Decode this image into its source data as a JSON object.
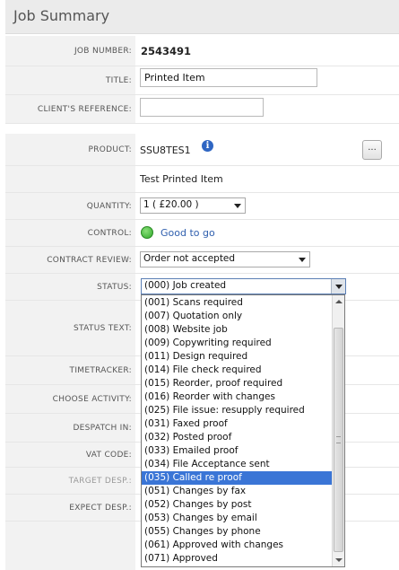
{
  "header": {
    "title": "Job Summary"
  },
  "fields": {
    "job_number": {
      "label": "JOB NUMBER:",
      "value": "2543491"
    },
    "title": {
      "label": "TITLE:",
      "value": "Printed Item"
    },
    "client_reference": {
      "label": "CLIENT'S REFERENCE:",
      "value": ""
    },
    "product": {
      "label": "PRODUCT:",
      "code": "SSU8TES1",
      "more_label": "...",
      "name": "Test Printed Item"
    },
    "quantity": {
      "label": "QUANTITY:",
      "value": "1 ( £20.00 )"
    },
    "control": {
      "label": "CONTROL:",
      "value": "Good to go"
    },
    "contract_review": {
      "label": "CONTRACT REVIEW:",
      "value": "Order not accepted"
    },
    "status": {
      "label": "STATUS:",
      "value": "(000) Job created"
    },
    "status_text": {
      "label": "STATUS TEXT:"
    },
    "timetracker": {
      "label": "TIMETRACKER:"
    },
    "choose_activity": {
      "label": "CHOOSE ACTIVITY:"
    },
    "despatch_in": {
      "label": "DESPATCH IN:"
    },
    "vat_code": {
      "label": "VAT CODE:"
    },
    "target_desp": {
      "label": "TARGET DESP.:"
    },
    "expect_desp": {
      "label": "EXPECT DESP.:"
    }
  },
  "status_options": [
    "(001) Scans required",
    "(007) Quotation only",
    "(008) Website job",
    "(009) Copywriting required",
    "(011) Design required",
    "(014) File check required",
    "(015) Reorder, proof required",
    "(016) Reorder with changes",
    "(025) File issue: resupply required",
    "(031) Faxed proof",
    "(032) Posted proof",
    "(033) Emailed proof",
    "(034) File Acceptance sent",
    "(035) Called re proof",
    "(051) Changes by fax",
    "(052) Changes by post",
    "(053) Changes by email",
    "(055) Changes by phone",
    "(061) Approved with changes",
    "(071) Approved"
  ],
  "highlighted_option": "(035) Called re proof",
  "icons": {
    "info": "info-icon",
    "control_status": "green-status-icon"
  },
  "colors": {
    "highlight": "#3a75d6",
    "control_good": "#2fa82a",
    "link": "#2f5fae"
  }
}
